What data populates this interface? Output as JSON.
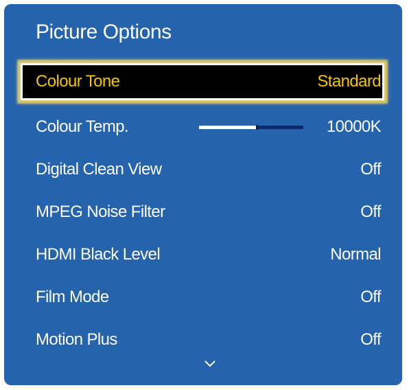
{
  "menu": {
    "title": "Picture Options",
    "items": [
      {
        "label": "Colour Tone",
        "value": "Standard"
      },
      {
        "label": "Colour Temp.",
        "value": "10000K",
        "slider_level": 0.55
      },
      {
        "label": "Digital Clean View",
        "value": "Off"
      },
      {
        "label": "MPEG Noise Filter",
        "value": "Off"
      },
      {
        "label": "HDMI Black Level",
        "value": "Normal"
      },
      {
        "label": "Film Mode",
        "value": "Off"
      },
      {
        "label": "Motion Plus",
        "value": "Off"
      }
    ],
    "more_indicator": "chevron-down-icon"
  },
  "colors": {
    "panel_background": "#2563ad",
    "selected_text": "#f2c400",
    "selected_background": "#000000",
    "selected_glow": "#f5d35a",
    "text": "#ffffff",
    "slider_track": "#0d2a6e",
    "slider_fill": "#ffffff"
  }
}
